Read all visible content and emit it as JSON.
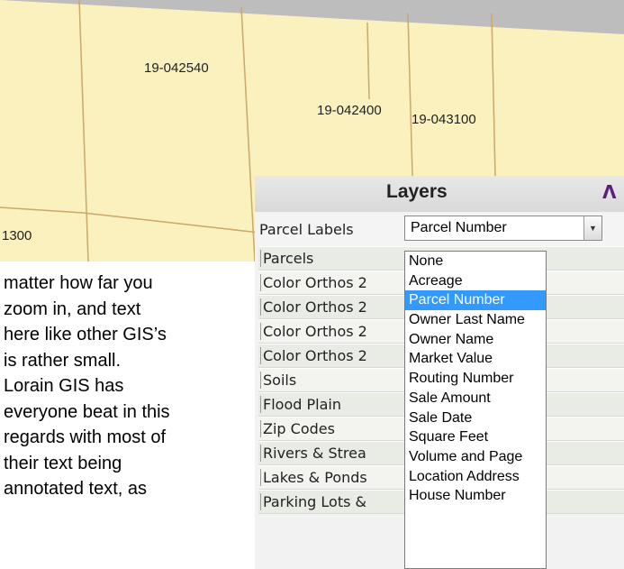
{
  "map": {
    "parcel_labels": [
      "19-042540",
      "19-042400",
      "19-043100",
      "1300"
    ]
  },
  "body_text": {
    "lines": [
      "matter how far you",
      "zoom in, and text",
      "here like other GIS’s",
      "is rather small.",
      "Lorain GIS has",
      "everyone beat in this",
      "regards with most of",
      "their text being",
      "annotated text, as"
    ]
  },
  "layers_panel": {
    "title": "Layers",
    "collapse_icon": "chevron-up-icon",
    "collapse_glyph": "Λ",
    "parcel_labels_caption": "Parcel Labels",
    "select_value": "Parcel Number",
    "layers": [
      "Parcels",
      "Color Orthos 2",
      "Color Orthos 2",
      "Color Orthos 2",
      "Color Orthos 2",
      "Soils",
      "Flood Plain",
      "Zip Codes",
      "Rivers & Strea",
      "Lakes & Ponds",
      "Parking Lots &"
    ]
  },
  "dropdown": {
    "options": [
      "None",
      "Acreage",
      "Parcel Number",
      "Owner Last Name",
      "Owner Name",
      "Market Value",
      "Routing Number",
      "Sale Amount",
      "Sale Date",
      "Square Feet",
      "Volume and Page",
      "Location Address",
      "House Number"
    ],
    "selected": "Parcel Number",
    "selected_color": "#3399ff"
  },
  "colors": {
    "map_fill": "#fbf1bf",
    "parcel_line": "#c9a86a",
    "road": "#b9b9b9"
  }
}
